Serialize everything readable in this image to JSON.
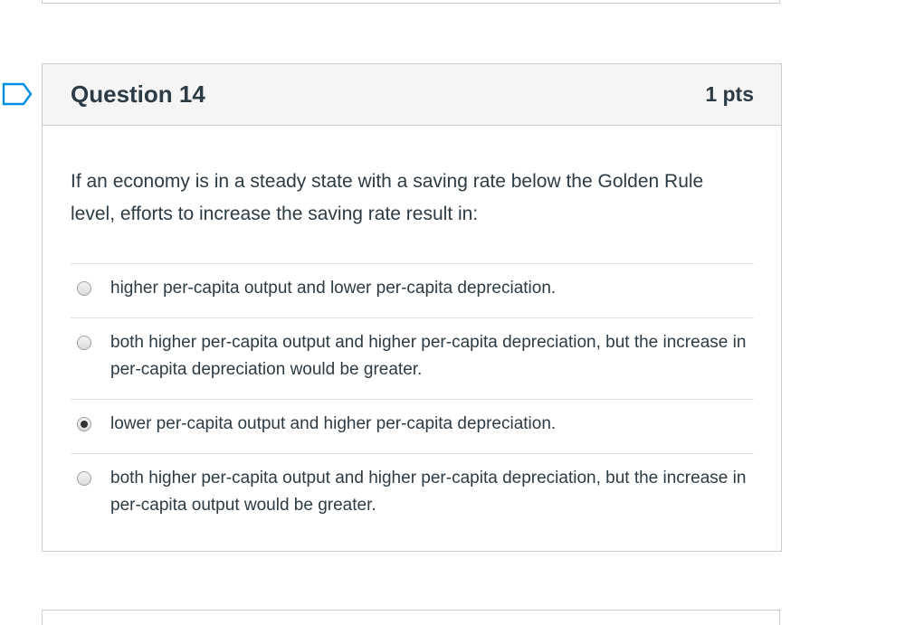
{
  "question": {
    "title": "Question 14",
    "points": "1 pts",
    "text": "If an economy is in a steady state with a saving rate below the Golden Rule level, efforts to increase the saving rate result in:",
    "answers": [
      {
        "label": "higher per-capita output and lower per-capita depreciation.",
        "selected": false
      },
      {
        "label": "both higher per-capita output and higher per-capita depreciation, but the increase in per-capita depreciation would be greater.",
        "selected": false
      },
      {
        "label": "lower per-capita output and higher per-capita depreciation.",
        "selected": true
      },
      {
        "label": "both higher per-capita output and higher per-capita depreciation, but the increase in per-capita output would be greater.",
        "selected": false
      }
    ]
  },
  "icons": {
    "flag": "flag-bookmark-icon"
  },
  "colors": {
    "text": "#2d3b45",
    "border": "#c7cdd1",
    "header_bg": "#f5f5f5",
    "flag": "#008ee2"
  }
}
